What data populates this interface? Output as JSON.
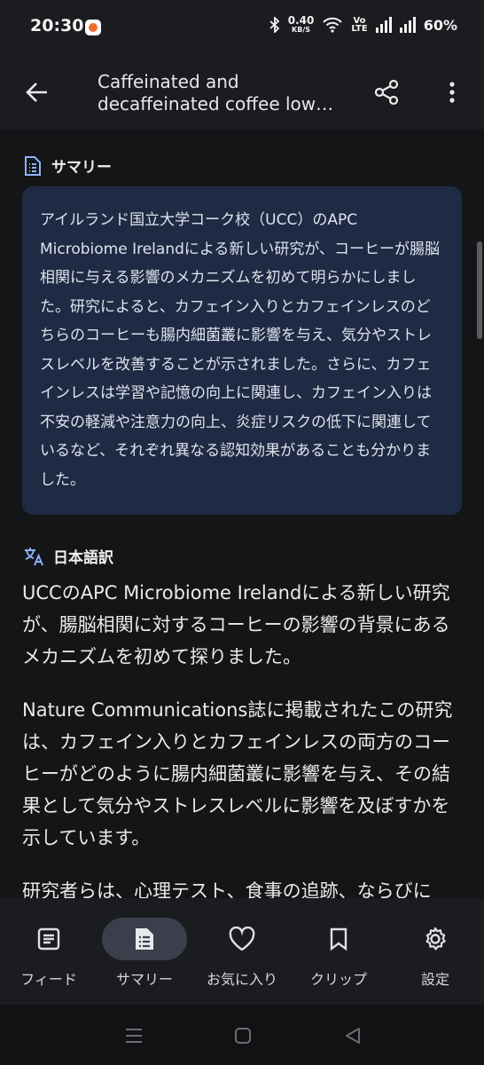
{
  "status_bar": {
    "time": "20:30",
    "net_speed_value": "0.40",
    "net_speed_unit": "KB/S",
    "volte_top": "Vo",
    "volte_bottom": "LTE",
    "battery": "60%"
  },
  "app_bar": {
    "title": "Caffeinated and decaffeinated coffee low…"
  },
  "summary": {
    "heading": "サマリー",
    "text": "アイルランド国立大学コーク校（UCC）のAPC Microbiome Irelandによる新しい研究が、コーヒーが腸脳相関に与える影響のメカニズムを初めて明らかにしました。研究によると、カフェイン入りとカフェインレスのどちらのコーヒーも腸内細菌叢に影響を与え、気分やストレスレベルを改善することが示されました。さらに、カフェインレスは学習や記憶の向上に関連し、カフェイン入りは不安の軽減や注意力の向上、炎症リスクの低下に関連しているなど、それぞれ異なる認知効果があることも分かりました。"
  },
  "translation": {
    "heading": "日本語訳",
    "paragraphs": [
      "UCCのAPC Microbiome Irelandによる新しい研究が、腸脳相関に対するコーヒーの影響の背景にあるメカニズムを初めて探りました。",
      "Nature Communications誌に掲載されたこの研究は、カフェイン入りとカフェインレスの両方のコーヒーがどのように腸内細菌叢に影響を与え、その結果として気分やストレスレベルに影響を及ぼすかを示しています。",
      "研究者らは、心理テスト、食事の追跡、ならびに"
    ]
  },
  "bottom_nav": {
    "items": [
      {
        "label": "フィード",
        "icon": "feed-icon"
      },
      {
        "label": "サマリー",
        "icon": "summary-icon"
      },
      {
        "label": "お気に入り",
        "icon": "heart-icon"
      },
      {
        "label": "クリップ",
        "icon": "bookmark-icon"
      },
      {
        "label": "設定",
        "icon": "gear-icon"
      }
    ],
    "active_index": 1
  },
  "colors": {
    "background": "#141517",
    "bar": "#1b1c1f",
    "card": "#1f2a44",
    "accent_icon": "#8fb4ff"
  }
}
